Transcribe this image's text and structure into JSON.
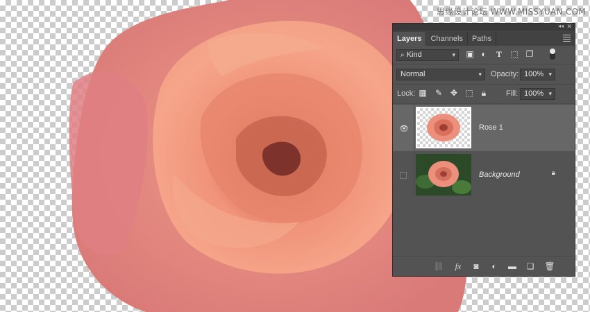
{
  "watermark": "思缘设计论坛 WWW.MISSYUAN.COM",
  "panel": {
    "tabs": [
      "Layers",
      "Channels",
      "Paths"
    ],
    "filter": {
      "label": "Kind"
    },
    "blend_mode": "Normal",
    "opacity_label": "Opacity:",
    "opacity_value": "100%",
    "lock_label": "Lock:",
    "fill_label": "Fill:",
    "fill_value": "100%",
    "layers": [
      {
        "name": "Rose 1",
        "selected": true,
        "visible": true,
        "locked": false
      },
      {
        "name": "Background",
        "selected": false,
        "visible": false,
        "locked": true
      }
    ],
    "footer_icons": [
      "link-icon",
      "fx-icon",
      "mask-icon",
      "adjustment-icon",
      "group-folder-icon",
      "new-layer-icon",
      "trash-icon"
    ]
  },
  "colors": {
    "panel_bg": "#535353",
    "selected_layer": "#676767",
    "rose_main": "#f0937a",
    "rose_outer": "#e58a8a"
  }
}
